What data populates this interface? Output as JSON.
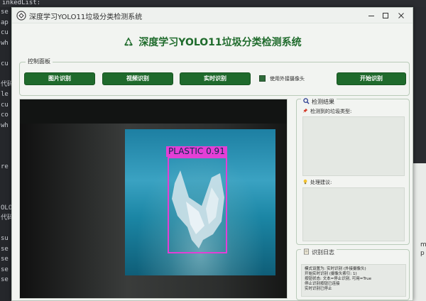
{
  "editor": {
    "top_text": "inkedList:",
    "left_lines": [
      "se",
      "ap",
      "cu",
      "wh",
      "",
      "cu",
      "",
      "代码",
      "le",
      "cu",
      "co",
      "wh",
      "",
      "",
      "",
      "re",
      "",
      "",
      "",
      "OLO",
      "代码",
      "",
      "su",
      "se",
      "se",
      "se",
      "se"
    ],
    "right_frags": [
      "mo",
      "p"
    ]
  },
  "window": {
    "title": "深度学习YOLO11垃圾分类检测系统"
  },
  "header": {
    "title": "深度学习YOLO11垃圾分类检测系统"
  },
  "control_panel": {
    "label": "控制面板",
    "buttons": {
      "image": "图片识别",
      "video": "视频识别",
      "realtime": "实时识别",
      "start": "开始识别"
    },
    "external_camera_label": "使用外接摄像头",
    "external_camera_checked": true
  },
  "detection": {
    "label": "PLASTIC",
    "confidence": "0.91"
  },
  "results": {
    "title": "检测结果",
    "types_label": "检测到的垃圾类型:",
    "types_value": "",
    "advice_label": "处理建议:",
    "advice_value": ""
  },
  "log": {
    "title": "识别日志",
    "lines": [
      "模式设置为: 实时识别 (外接摄像头)",
      "开始实时识别 (摄像头索引: 1)",
      "按钮状态: 文本=停止识别, 可用=True",
      "停止识别按钮已连接",
      "实时识别已停止"
    ]
  },
  "colors": {
    "accent": "#1f6a2c",
    "title_green": "#1f6b2c",
    "detection_box": "#e33fd6"
  },
  "icons": {
    "app": "recycle-icon",
    "results": "magnifier-icon",
    "types": "pin-icon",
    "advice": "lightbulb-icon",
    "log": "notepad-icon"
  }
}
